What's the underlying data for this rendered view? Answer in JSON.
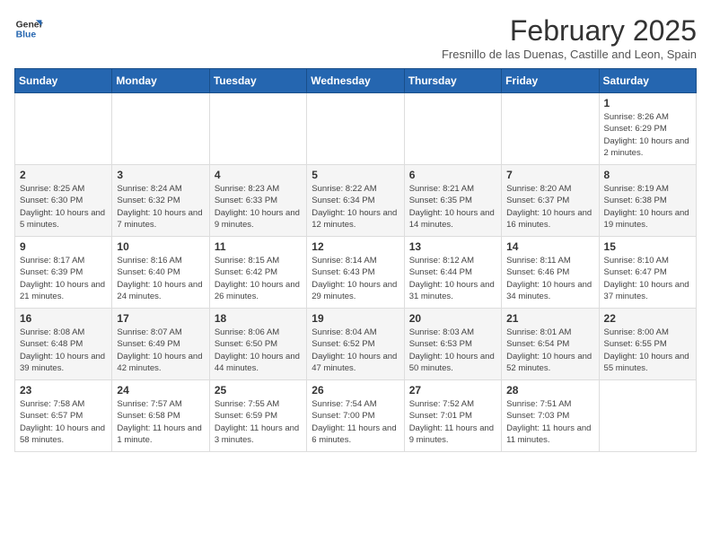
{
  "logo": {
    "line1": "General",
    "line2": "Blue"
  },
  "title": "February 2025",
  "subtitle": "Fresnillo de las Duenas, Castille and Leon, Spain",
  "weekdays": [
    "Sunday",
    "Monday",
    "Tuesday",
    "Wednesday",
    "Thursday",
    "Friday",
    "Saturday"
  ],
  "weeks": [
    [
      {
        "day": "",
        "info": ""
      },
      {
        "day": "",
        "info": ""
      },
      {
        "day": "",
        "info": ""
      },
      {
        "day": "",
        "info": ""
      },
      {
        "day": "",
        "info": ""
      },
      {
        "day": "",
        "info": ""
      },
      {
        "day": "1",
        "info": "Sunrise: 8:26 AM\nSunset: 6:29 PM\nDaylight: 10 hours and 2 minutes."
      }
    ],
    [
      {
        "day": "2",
        "info": "Sunrise: 8:25 AM\nSunset: 6:30 PM\nDaylight: 10 hours and 5 minutes."
      },
      {
        "day": "3",
        "info": "Sunrise: 8:24 AM\nSunset: 6:32 PM\nDaylight: 10 hours and 7 minutes."
      },
      {
        "day": "4",
        "info": "Sunrise: 8:23 AM\nSunset: 6:33 PM\nDaylight: 10 hours and 9 minutes."
      },
      {
        "day": "5",
        "info": "Sunrise: 8:22 AM\nSunset: 6:34 PM\nDaylight: 10 hours and 12 minutes."
      },
      {
        "day": "6",
        "info": "Sunrise: 8:21 AM\nSunset: 6:35 PM\nDaylight: 10 hours and 14 minutes."
      },
      {
        "day": "7",
        "info": "Sunrise: 8:20 AM\nSunset: 6:37 PM\nDaylight: 10 hours and 16 minutes."
      },
      {
        "day": "8",
        "info": "Sunrise: 8:19 AM\nSunset: 6:38 PM\nDaylight: 10 hours and 19 minutes."
      }
    ],
    [
      {
        "day": "9",
        "info": "Sunrise: 8:17 AM\nSunset: 6:39 PM\nDaylight: 10 hours and 21 minutes."
      },
      {
        "day": "10",
        "info": "Sunrise: 8:16 AM\nSunset: 6:40 PM\nDaylight: 10 hours and 24 minutes."
      },
      {
        "day": "11",
        "info": "Sunrise: 8:15 AM\nSunset: 6:42 PM\nDaylight: 10 hours and 26 minutes."
      },
      {
        "day": "12",
        "info": "Sunrise: 8:14 AM\nSunset: 6:43 PM\nDaylight: 10 hours and 29 minutes."
      },
      {
        "day": "13",
        "info": "Sunrise: 8:12 AM\nSunset: 6:44 PM\nDaylight: 10 hours and 31 minutes."
      },
      {
        "day": "14",
        "info": "Sunrise: 8:11 AM\nSunset: 6:46 PM\nDaylight: 10 hours and 34 minutes."
      },
      {
        "day": "15",
        "info": "Sunrise: 8:10 AM\nSunset: 6:47 PM\nDaylight: 10 hours and 37 minutes."
      }
    ],
    [
      {
        "day": "16",
        "info": "Sunrise: 8:08 AM\nSunset: 6:48 PM\nDaylight: 10 hours and 39 minutes."
      },
      {
        "day": "17",
        "info": "Sunrise: 8:07 AM\nSunset: 6:49 PM\nDaylight: 10 hours and 42 minutes."
      },
      {
        "day": "18",
        "info": "Sunrise: 8:06 AM\nSunset: 6:50 PM\nDaylight: 10 hours and 44 minutes."
      },
      {
        "day": "19",
        "info": "Sunrise: 8:04 AM\nSunset: 6:52 PM\nDaylight: 10 hours and 47 minutes."
      },
      {
        "day": "20",
        "info": "Sunrise: 8:03 AM\nSunset: 6:53 PM\nDaylight: 10 hours and 50 minutes."
      },
      {
        "day": "21",
        "info": "Sunrise: 8:01 AM\nSunset: 6:54 PM\nDaylight: 10 hours and 52 minutes."
      },
      {
        "day": "22",
        "info": "Sunrise: 8:00 AM\nSunset: 6:55 PM\nDaylight: 10 hours and 55 minutes."
      }
    ],
    [
      {
        "day": "23",
        "info": "Sunrise: 7:58 AM\nSunset: 6:57 PM\nDaylight: 10 hours and 58 minutes."
      },
      {
        "day": "24",
        "info": "Sunrise: 7:57 AM\nSunset: 6:58 PM\nDaylight: 11 hours and 1 minute."
      },
      {
        "day": "25",
        "info": "Sunrise: 7:55 AM\nSunset: 6:59 PM\nDaylight: 11 hours and 3 minutes."
      },
      {
        "day": "26",
        "info": "Sunrise: 7:54 AM\nSunset: 7:00 PM\nDaylight: 11 hours and 6 minutes."
      },
      {
        "day": "27",
        "info": "Sunrise: 7:52 AM\nSunset: 7:01 PM\nDaylight: 11 hours and 9 minutes."
      },
      {
        "day": "28",
        "info": "Sunrise: 7:51 AM\nSunset: 7:03 PM\nDaylight: 11 hours and 11 minutes."
      },
      {
        "day": "",
        "info": ""
      }
    ]
  ]
}
